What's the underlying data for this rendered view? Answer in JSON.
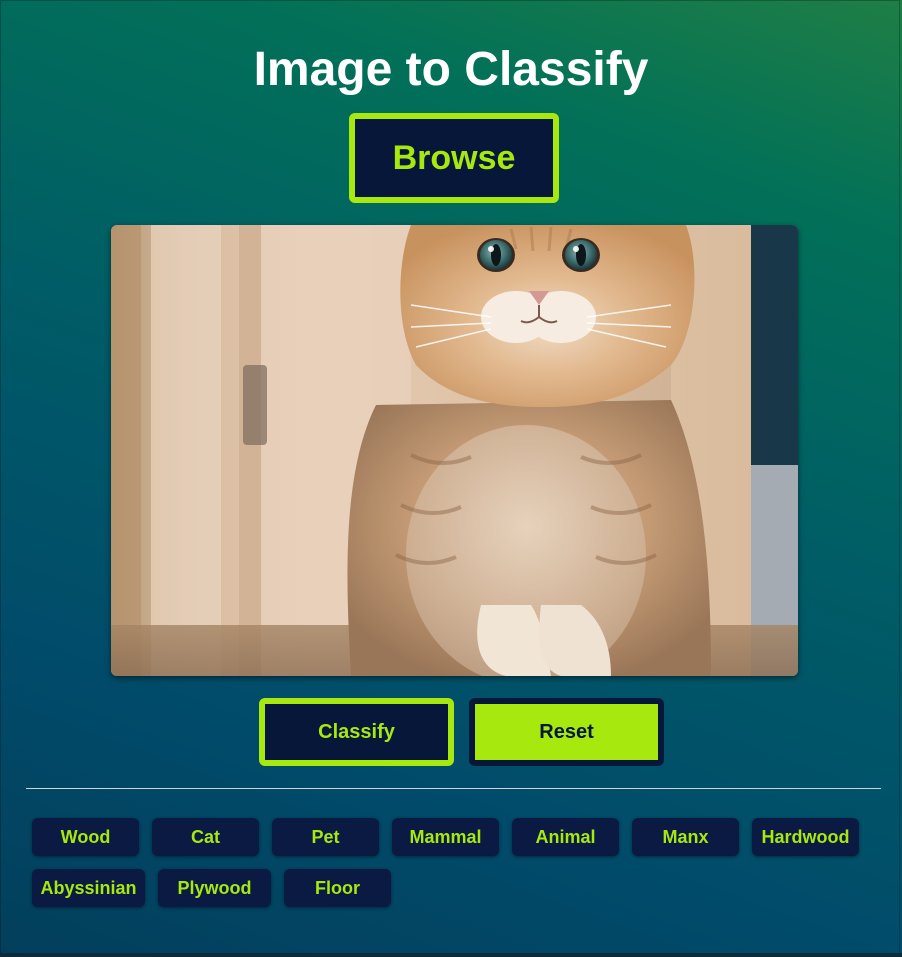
{
  "page": {
    "title": "Image to Classify"
  },
  "controls": {
    "browse_label": "Browse",
    "classify_label": "Classify",
    "reset_label": "Reset"
  },
  "preview": {
    "subject": "cat photo"
  },
  "tags": [
    "Wood",
    "Cat",
    "Pet",
    "Mammal",
    "Animal",
    "Manx",
    "Hardwood",
    "Abyssinian",
    "Plywood",
    "Floor"
  ],
  "colors": {
    "accent": "#a7e80f",
    "button_dark": "#07173a",
    "tag_bg": "#0a1a42",
    "title": "#ffffff"
  }
}
